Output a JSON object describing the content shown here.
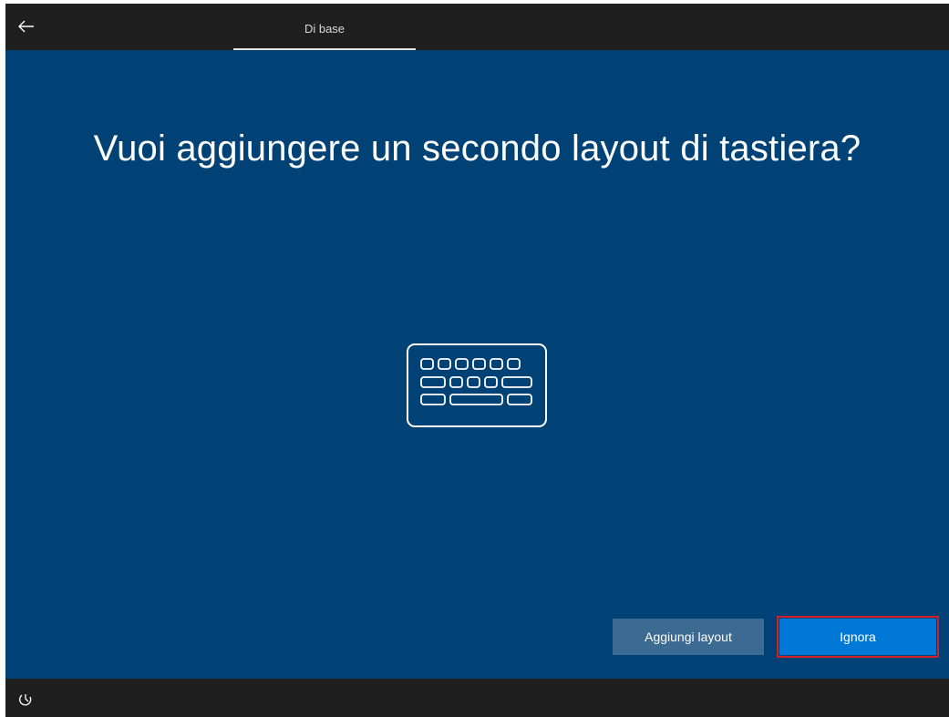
{
  "header": {
    "back_icon": "arrow-left-icon",
    "tab_label": "Di base"
  },
  "main": {
    "title": "Vuoi aggiungere un secondo layout di tastiera?",
    "illustration_icon": "keyboard-icon",
    "add_layout_label": "Aggiungi layout",
    "skip_label": "Ignora"
  },
  "footer": {
    "accessibility_icon": "ease-of-access-icon"
  },
  "colors": {
    "background": "#004275",
    "topbar": "#1f1f1f",
    "primary_button": "#0078d7",
    "secondary_button": "#3b6a92",
    "highlight_border": "#d0202a"
  }
}
